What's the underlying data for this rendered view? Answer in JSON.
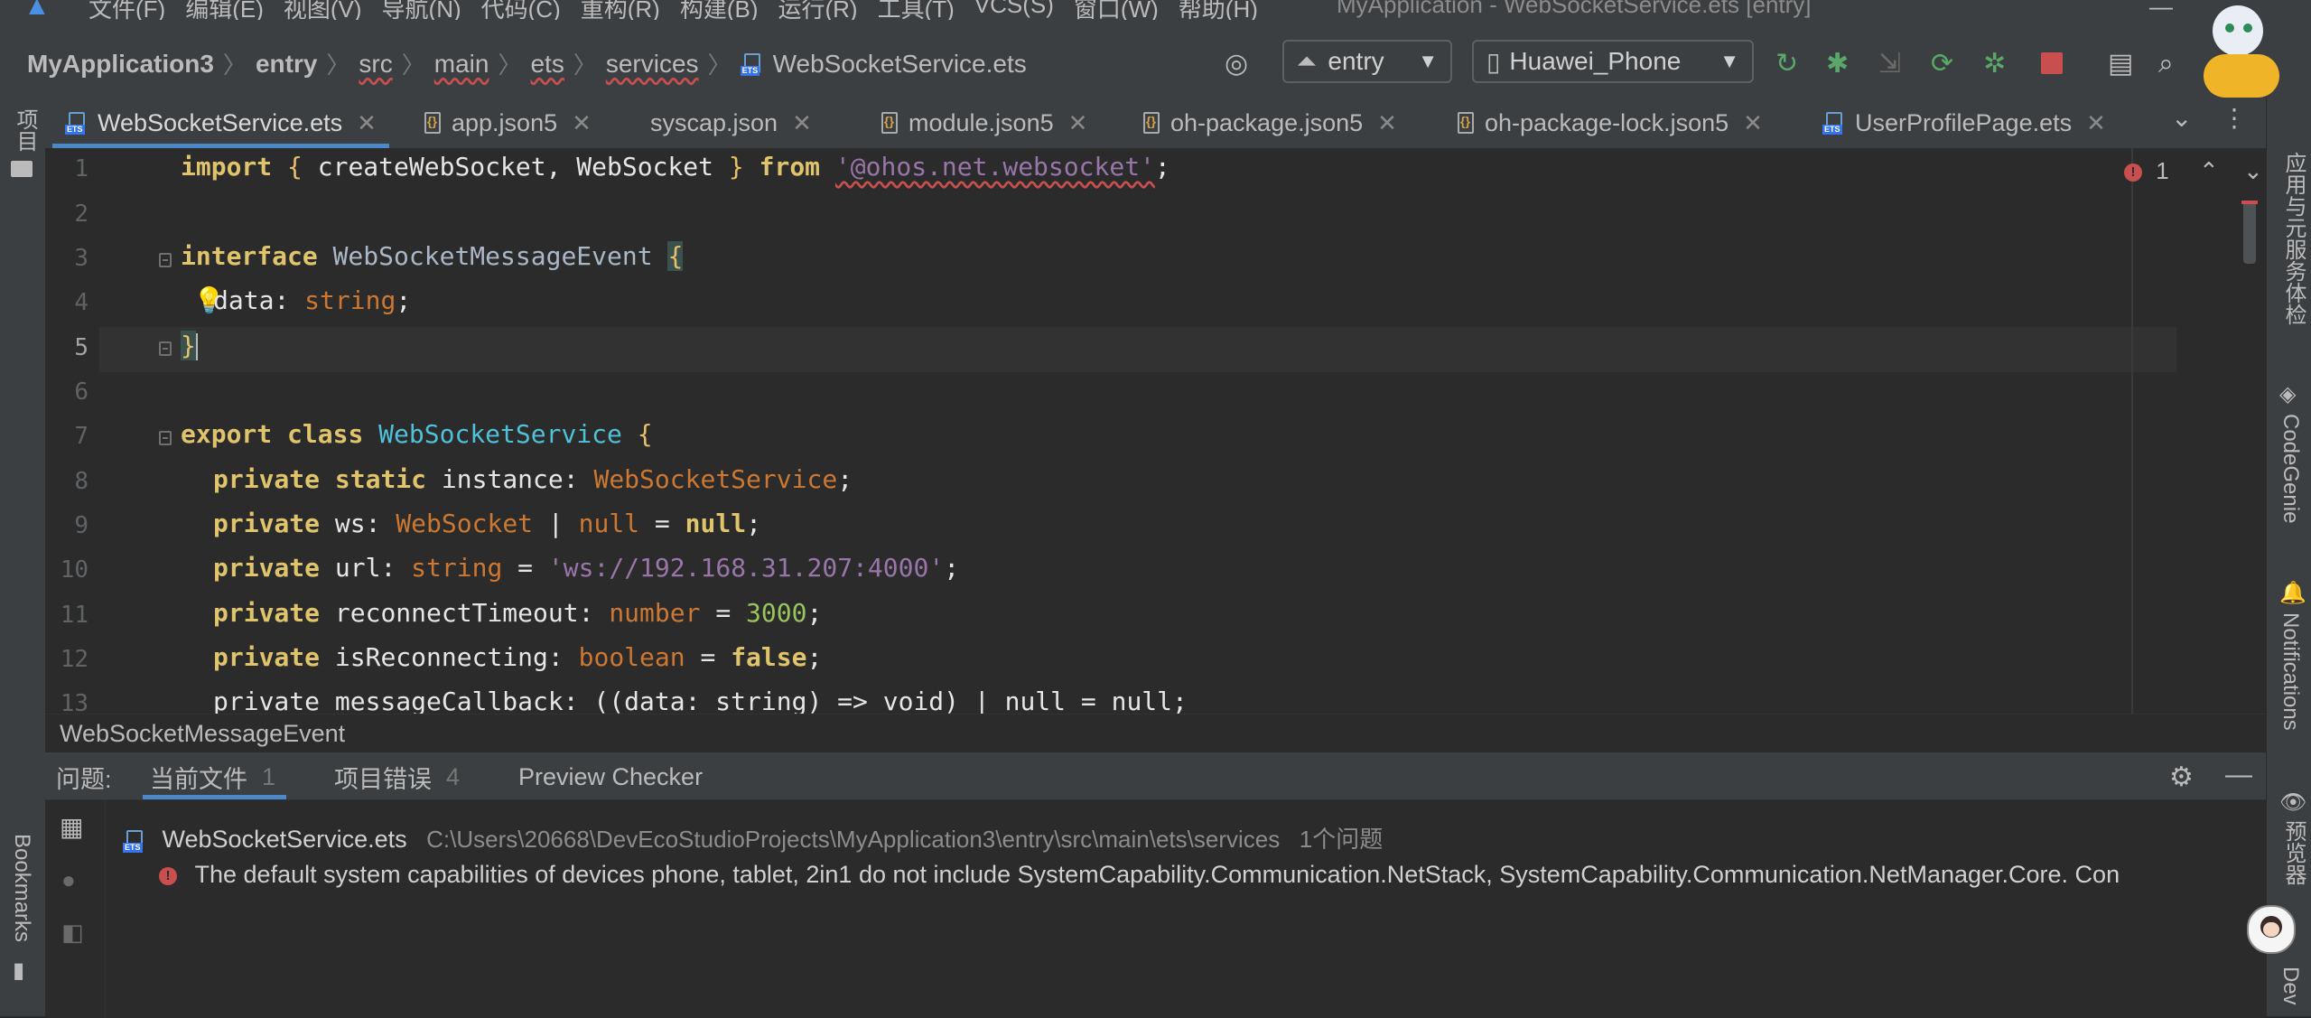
{
  "window": {
    "menu": [
      "文件(F)",
      "编辑(E)",
      "视图(V)",
      "导航(N)",
      "代码(C)",
      "重构(R)",
      "构建(B)",
      "运行(R)",
      "工具(T)",
      "VCS(S)",
      "窗口(W)",
      "帮助(H)"
    ],
    "title": "MyApplication - WebSocketService.ets [entry]"
  },
  "navbar": {
    "breadcrumb": [
      "MyApplication3",
      "entry",
      "src",
      "main",
      "ets",
      "services",
      "WebSocketService.ets"
    ],
    "module_select": "entry",
    "device_select": "Huawei_Phone"
  },
  "tabs": [
    {
      "label": "WebSocketService.ets",
      "icon": "ets-file-icon",
      "active": true
    },
    {
      "label": "app.json5",
      "icon": "json-file-icon"
    },
    {
      "label": "syscap.json",
      "icon": "json-file-icon"
    },
    {
      "label": "module.json5",
      "icon": "json-file-icon"
    },
    {
      "label": "oh-package.json5",
      "icon": "json-file-icon"
    },
    {
      "label": "oh-package-lock.json5",
      "icon": "json-file-icon"
    },
    {
      "label": "UserProfilePage.ets",
      "icon": "ets-file-icon"
    }
  ],
  "editor": {
    "error_count": "1",
    "line_numbers": [
      "1",
      "2",
      "3",
      "4",
      "5",
      "6",
      "7",
      "8",
      "9",
      "10",
      "11",
      "12",
      "13"
    ],
    "code": {
      "l1": {
        "kw": "import",
        "b1": "{",
        "names": " createWebSocket, WebSocket ",
        "b2": "}",
        "from": "from",
        "module": "'@ohos.net.websocket'",
        "end": ";"
      },
      "l3": {
        "kw": "interface",
        "name": "WebSocketMessageEvent",
        "brace": "{"
      },
      "l4": {
        "field": "data",
        "colon": ": ",
        "type": "string",
        "end": ";"
      },
      "l5": {
        "brace": "}"
      },
      "l7": {
        "kw1": "export",
        "kw2": "class",
        "name": "WebSocketService",
        "brace": "{"
      },
      "l8": {
        "kw1": "private",
        "kw2": "static",
        "field": "instance",
        "type": "WebSocketService"
      },
      "l9": {
        "kw": "private",
        "field": "ws",
        "type": "WebSocket",
        "pipe": "|",
        "nulltype": "null",
        "value": "null"
      },
      "l10": {
        "kw": "private",
        "field": "url",
        "type": "string",
        "value": "'ws://192.168.31.207:4000'"
      },
      "l11": {
        "kw": "private",
        "field": "reconnectTimeout",
        "type": "number",
        "value": "3000"
      },
      "l12": {
        "kw": "private",
        "field": "isReconnecting",
        "type": "boolean",
        "value": "false"
      },
      "l13": {
        "text": "private messageCallback: ((data: string) => void) | null = null;"
      }
    }
  },
  "footer_crumb": "WebSocketMessageEvent",
  "problems": {
    "label": "问题:",
    "tabs": [
      {
        "label": "当前文件",
        "count": "1",
        "active": true
      },
      {
        "label": "项目错误",
        "count": "4"
      },
      {
        "label": "Preview Checker",
        "count": ""
      }
    ],
    "file": {
      "name": "WebSocketService.ets",
      "path": "C:\\Users\\20668\\DevEcoStudioProjects\\MyApplication3\\entry\\src\\main\\ets\\services",
      "summary": "1个问题"
    },
    "message": "The default system capabilities of devices phone, tablet, 2in1 do not include SystemCapability.Communication.NetStack, SystemCapability.Communication.NetManager.Core. Con"
  },
  "side": {
    "left_top": "项目",
    "left_bottom": "Bookmarks",
    "right": [
      "应用与元服务体检",
      "CodeGenie",
      "Notifications",
      "预览器",
      "Dev"
    ]
  },
  "colors": {
    "accent": "#4a88c7",
    "error": "#c94f4f",
    "background": "#2b2b2b",
    "chrome": "#3c3f41"
  }
}
